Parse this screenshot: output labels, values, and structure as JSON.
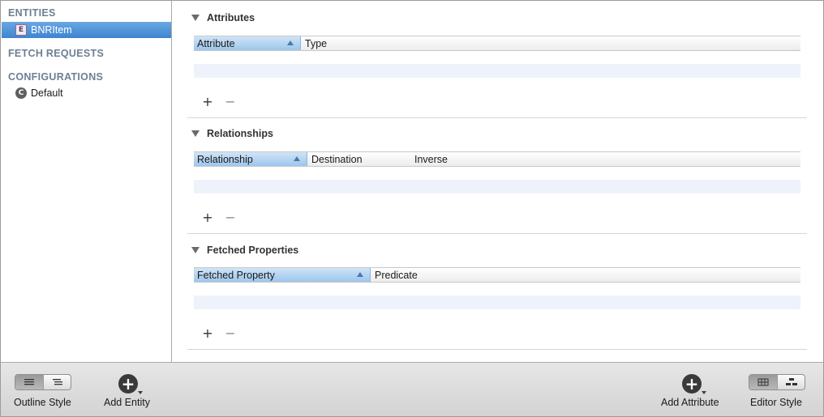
{
  "sidebar": {
    "sections": {
      "entities": "ENTITIES",
      "fetch_requests": "FETCH REQUESTS",
      "configurations": "CONFIGURATIONS"
    },
    "entities": [
      {
        "badge": "E",
        "label": "BNRItem",
        "selected": true
      }
    ],
    "configurations": [
      {
        "badge": "C",
        "label": "Default"
      }
    ]
  },
  "main": {
    "attributes": {
      "title": "Attributes",
      "columns": [
        "Attribute",
        "Type"
      ],
      "sorted_column": "Attribute",
      "add": "+",
      "remove": "−"
    },
    "relationships": {
      "title": "Relationships",
      "columns": [
        "Relationship",
        "Destination",
        "Inverse"
      ],
      "sorted_column": "Relationship",
      "add": "+",
      "remove": "−"
    },
    "fetched_properties": {
      "title": "Fetched Properties",
      "columns": [
        "Fetched Property",
        "Predicate"
      ],
      "sorted_column": "Fetched Property",
      "add": "+",
      "remove": "−"
    }
  },
  "footer": {
    "outline_style_label": "Outline Style",
    "add_entity_label": "Add Entity",
    "add_attribute_label": "Add Attribute",
    "editor_style_label": "Editor Style",
    "add_symbol": "+"
  },
  "icons": {
    "disclosure": "disclosure-triangle-icon",
    "outline_flat": "list-icon",
    "outline_hier": "hierarchy-list-icon",
    "editor_table": "table-icon",
    "editor_graph": "graph-icon"
  },
  "colors": {
    "selection": "#3d84d1",
    "sorted_header": "#9dc6ec",
    "section_label": "#6d7f94",
    "row_alt": "#eef3fb"
  }
}
